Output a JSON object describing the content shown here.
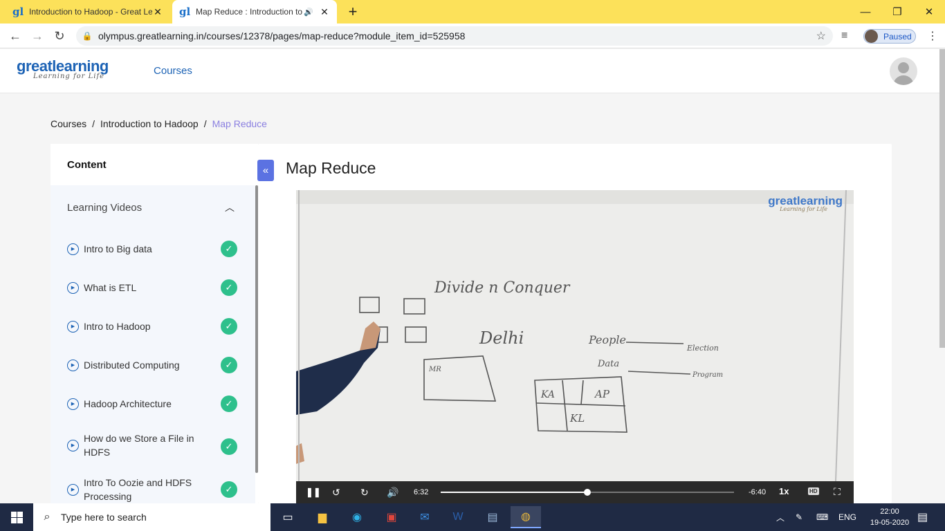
{
  "browser": {
    "tabs": [
      {
        "title": "Introduction to Hadoop - Great Learning",
        "favicon": "gl-icon",
        "active": false
      },
      {
        "title": "Map Reduce : Introduction to Hadoop",
        "favicon": "gl-icon",
        "active": true
      }
    ],
    "url": "olympus.greatlearning.in/courses/12378/pages/map-reduce?module_item_id=525958",
    "profile_status": "Paused"
  },
  "site": {
    "logo_main": "greatlearning",
    "logo_tagline": "Learning for Life",
    "nav_courses": "Courses"
  },
  "breadcrumb": {
    "items": [
      "Courses",
      "Introduction to Hadoop"
    ],
    "current": "Map Reduce",
    "separator": "/"
  },
  "sidebar": {
    "header": "Content",
    "section_title": "Learning Videos",
    "lessons": [
      {
        "label": "Intro to Big data",
        "completed": true
      },
      {
        "label": "What is ETL",
        "completed": true
      },
      {
        "label": "Intro to Hadoop",
        "completed": true
      },
      {
        "label": "Distributed Computing",
        "completed": true
      },
      {
        "label": "Hadoop Architecture",
        "completed": true
      },
      {
        "label": "How do we Store a File in HDFS",
        "completed": true
      },
      {
        "label": "Intro To Oozie and HDFS Processing",
        "completed": true
      }
    ]
  },
  "main": {
    "title": "Map Reduce",
    "video": {
      "watermark_main": "greatlearning",
      "watermark_tagline": "Learning for Life",
      "board_text": [
        "Divide n Conquer",
        "Delhi",
        "People",
        "Data",
        "Election",
        "Program",
        "KA",
        "AP",
        "KL",
        "MR"
      ],
      "elapsed": "6:32",
      "remaining": "-6:40",
      "speed": "1x",
      "progress": 0.5,
      "hd_label": "HD"
    }
  },
  "taskbar": {
    "search_placeholder": "Type here to search",
    "language": "ENG",
    "time": "22:00",
    "date": "19-05-2020"
  },
  "colors": {
    "tabstrip": "#fce15a",
    "brand_blue": "#1d63b5",
    "check_green": "#2ec08c",
    "accent_purple": "#5b72e2",
    "taskbar": "#1f2a44"
  }
}
